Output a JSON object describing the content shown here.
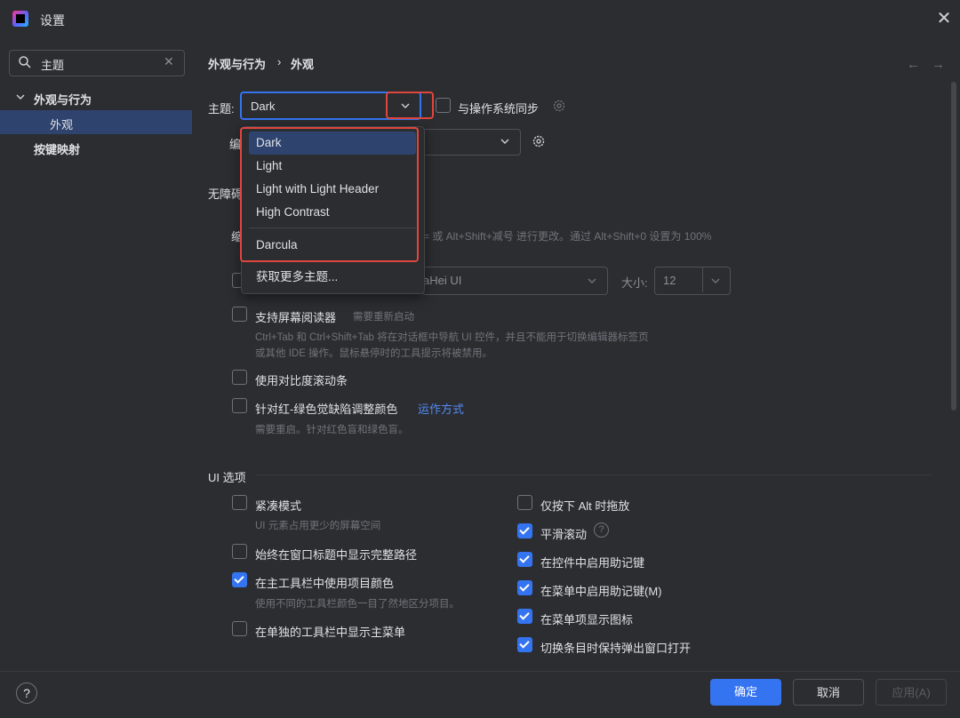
{
  "window": {
    "title": "设置"
  },
  "sidebar": {
    "search": {
      "value": "主题"
    },
    "tree": [
      {
        "label": "外观与行为",
        "expanded": true
      },
      {
        "label": "外观",
        "selected": true
      },
      {
        "label": "按键映射"
      }
    ]
  },
  "breadcrumb": {
    "parent": "外观与行为",
    "separator": "›",
    "current": "外观"
  },
  "theme": {
    "label": "主题:",
    "value": "Dark",
    "sync_label": "与操作系统同步",
    "options": [
      "Dark",
      "Light",
      "Light with Light Header",
      "High Contrast",
      "Darcula"
    ],
    "more": "获取更多主题..."
  },
  "partial_labels": {
    "editor_prefix": "编",
    "accessibility_prefix": "无障碍",
    "zoom_prefix": "缩",
    "zoom_hint_tail": "= 或 Alt+Shift+减号 进行更改。通过 Alt+Shift+0 设置为 100%",
    "font_value_tail": "aHei UI",
    "size_label": "大小:",
    "size_value": "12"
  },
  "accessibility": {
    "screen_reader": {
      "label": "支持屏幕阅读器",
      "note": "需要重新启动",
      "desc_line1": "Ctrl+Tab 和 Ctrl+Shift+Tab 将在对话框中导航 UI 控件，并且不能用于切换编辑器标签页",
      "desc_line2": "或其他 IDE 操作。鼠标悬停时的工具提示将被禁用。"
    },
    "contrast_scrollbars": {
      "label": "使用对比度滚动条"
    },
    "color_deficiency": {
      "label": "针对红-绿色觉缺陷调整颜色",
      "link": "运作方式",
      "desc": "需要重启。针对红色盲和绿色盲。"
    }
  },
  "ui_options": {
    "title": "UI 选项",
    "left": [
      {
        "label": "紧凑模式",
        "checked": false,
        "desc": "UI 元素占用更少的屏幕空间"
      },
      {
        "label": "始终在窗口标题中显示完整路径",
        "checked": false
      },
      {
        "label": "在主工具栏中使用项目颜色",
        "checked": true,
        "desc": "使用不同的工具栏颜色一目了然地区分项目。"
      },
      {
        "label": "在单独的工具栏中显示主菜单",
        "checked": false
      }
    ],
    "right": [
      {
        "label": "仅按下 Alt 时拖放",
        "checked": false
      },
      {
        "label": "平滑滚动",
        "checked": true
      },
      {
        "label": "在控件中启用助记键",
        "checked": true
      },
      {
        "label": "在菜单中启用助记键(M)",
        "checked": true
      },
      {
        "label": "在菜单项显示图标",
        "checked": true
      },
      {
        "label": "切换条目时保持弹出窗口打开",
        "checked": true
      }
    ]
  },
  "footer": {
    "help": "?",
    "ok": "确定",
    "cancel": "取消",
    "apply": "应用(A)"
  },
  "colors": {
    "accent": "#3574f0",
    "highlight": "#e0463e",
    "background": "#2b2d30"
  }
}
